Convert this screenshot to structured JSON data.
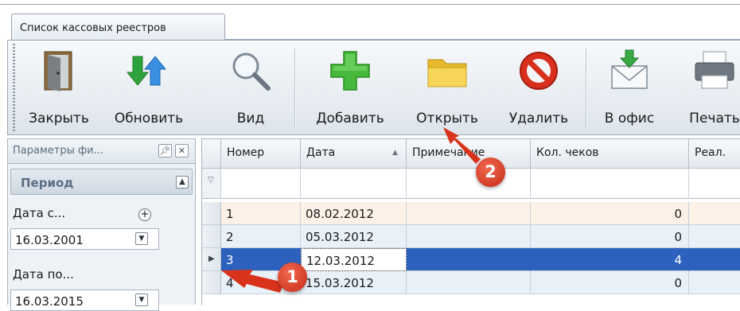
{
  "tab": {
    "title": "Список кассовых реестров"
  },
  "toolbar": {
    "buttons": [
      {
        "label": "Закрыть",
        "icon": "door-exit-icon"
      },
      {
        "label": "Обновить",
        "icon": "refresh-arrows-icon"
      },
      {
        "label": "Вид",
        "icon": "magnifier-icon"
      },
      {
        "label": "Добавить",
        "icon": "green-plus-icon"
      },
      {
        "label": "Открыть",
        "icon": "folder-icon"
      },
      {
        "label": "Удалить",
        "icon": "no-sign-icon"
      },
      {
        "label": "В офис",
        "icon": "envelope-arrow-icon"
      },
      {
        "label": "Печать",
        "icon": "printer-icon"
      }
    ]
  },
  "filter_panel": {
    "title": "Параметры фи...",
    "pin_icon": "pin-icon",
    "close_icon": "close-icon",
    "group_title": "Период",
    "date_from_label": "Дата с...",
    "date_from_value": "16.03.2001",
    "date_to_label": "Дата по...",
    "date_to_value": "16.03.2015"
  },
  "grid": {
    "columns": [
      "Номер",
      "Дата",
      "Примечание",
      "Кол. чеков",
      "Реал."
    ],
    "rows": [
      {
        "number": "1",
        "date": "08.02.2012",
        "note": "",
        "checks": "0"
      },
      {
        "number": "2",
        "date": "05.03.2012",
        "note": "",
        "checks": "0"
      },
      {
        "number": "3",
        "date": "12.03.2012",
        "note": "",
        "checks": "4"
      },
      {
        "number": "4",
        "date": "15.03.2012",
        "note": "",
        "checks": "0"
      }
    ],
    "selected_row": 3
  },
  "annotations": [
    {
      "label": "1"
    },
    {
      "label": "2"
    }
  ],
  "colors": {
    "selection": "#2c62bd",
    "annotation": "#d9331c",
    "row_even": "#fbf1e6",
    "row_alt": "#e8f0f8"
  }
}
